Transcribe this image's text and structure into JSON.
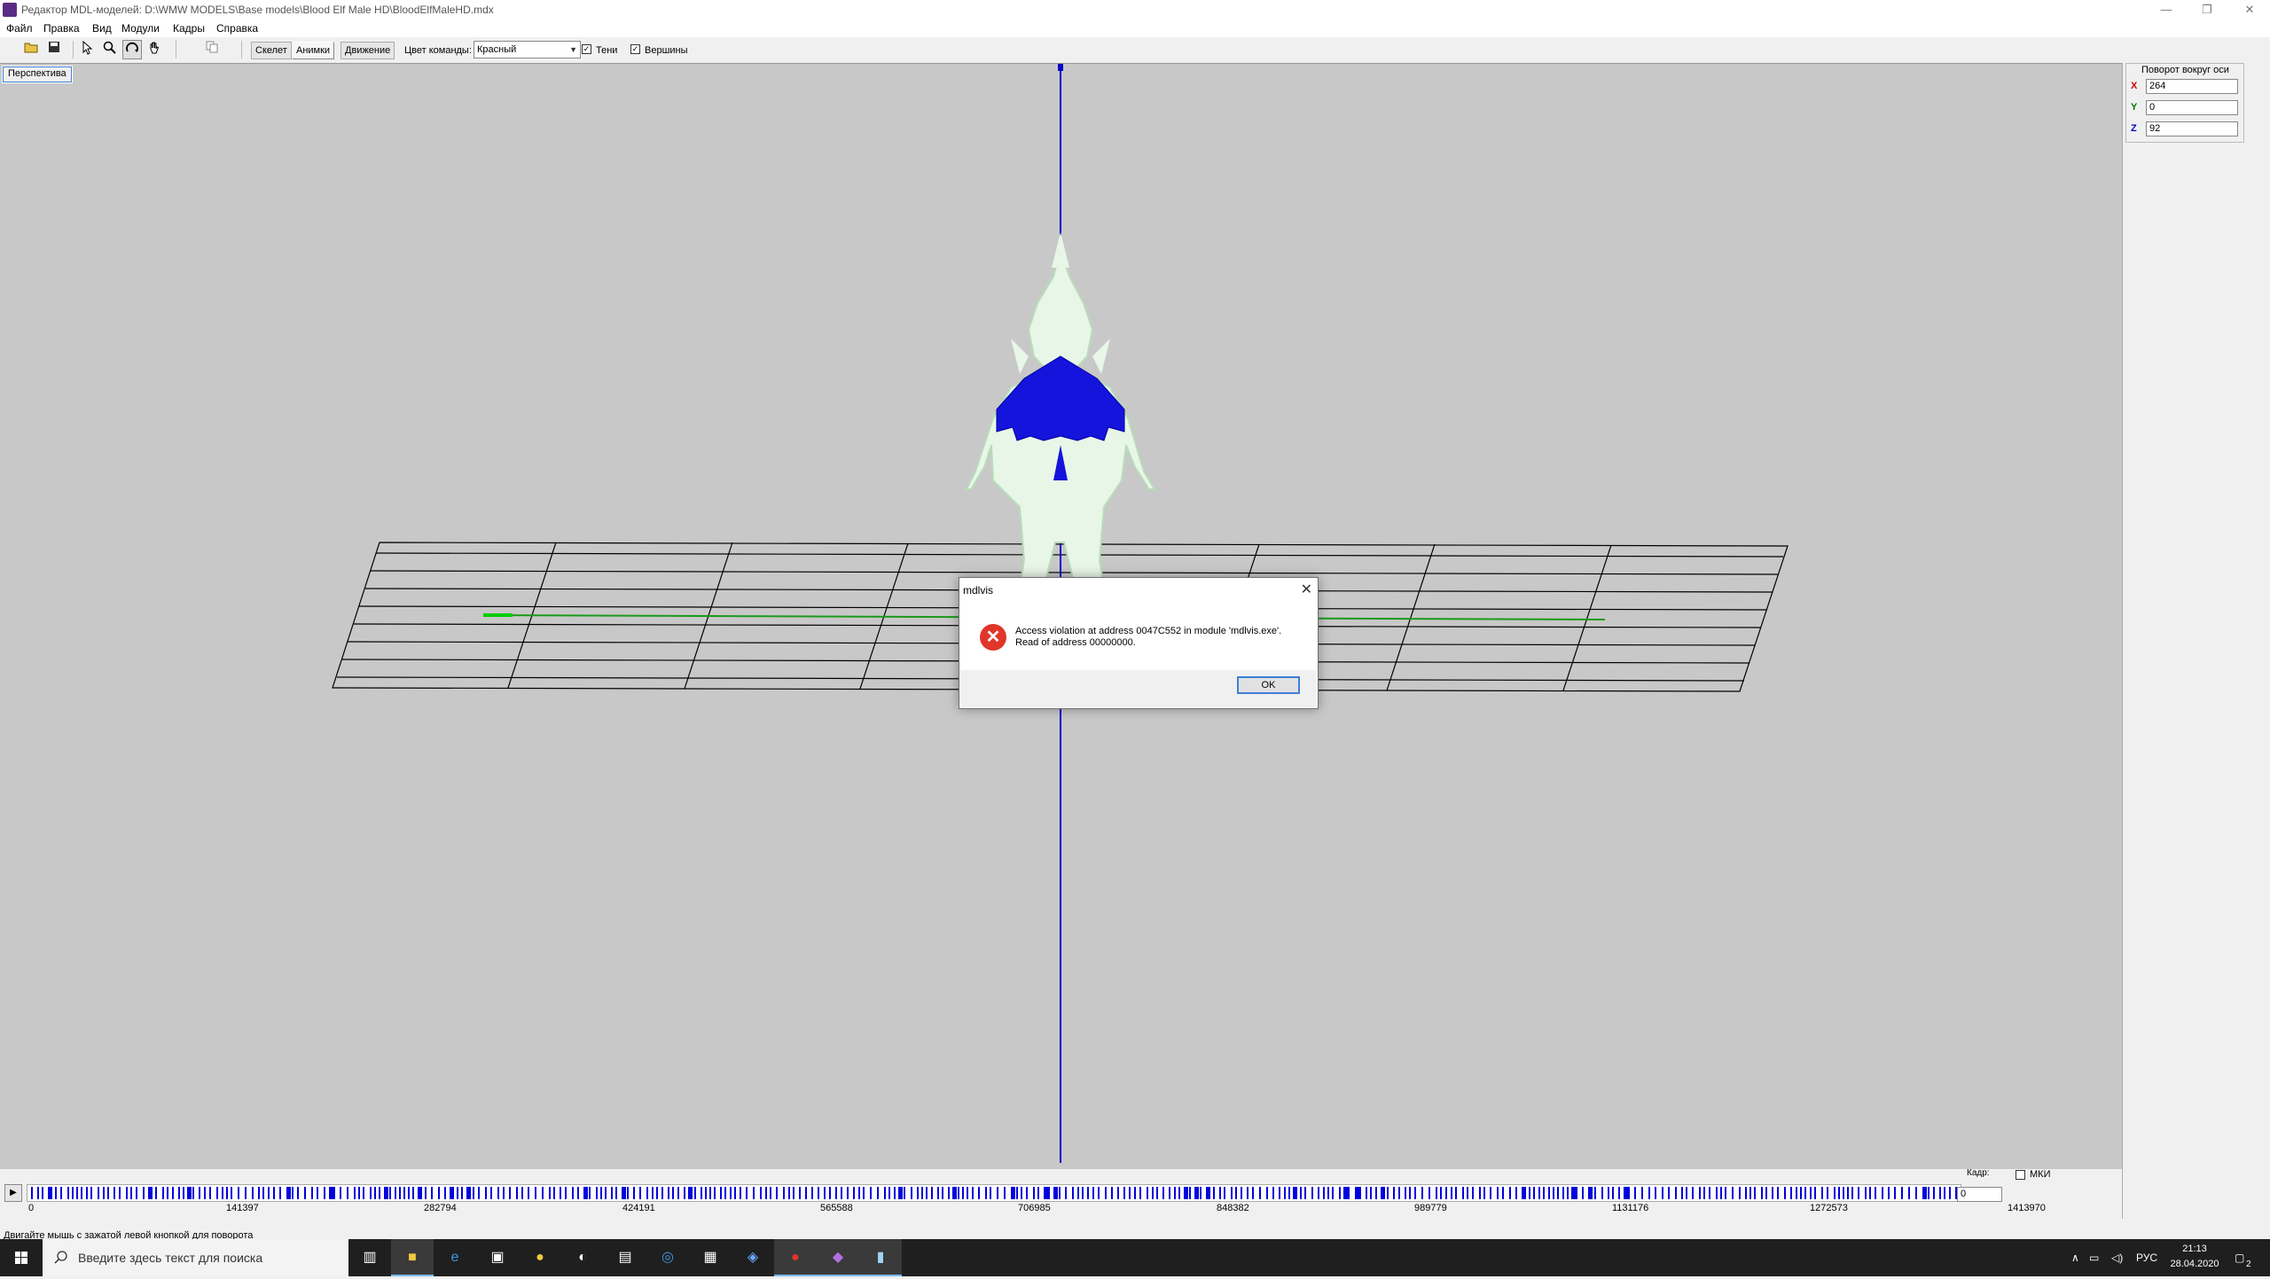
{
  "window": {
    "title": "Редактор MDL-моделей: D:\\WMW MODELS\\Base models\\Blood Elf Male HD\\BloodElfMaleHD.mdx",
    "controls": [
      "—",
      "❐",
      "✕"
    ]
  },
  "menu": [
    "Файл",
    "Правка",
    "Вид",
    "Модули",
    "Кадры",
    "Справка"
  ],
  "toolbar": {
    "tabs": [
      "Скелет",
      "Анимки",
      "Движение"
    ],
    "team_color_label": "Цвет команды:",
    "team_color_value": "Красный",
    "shadows_label": "Тени",
    "shadows_checked": true,
    "vertices_label": "Вершины",
    "vertices_checked": true
  },
  "viewport": {
    "perspective_button": "Перспектива"
  },
  "rotation_panel": {
    "title": "Поворот вокруг оси",
    "axes": [
      {
        "label": "X",
        "value": "264",
        "color": "#cc0000"
      },
      {
        "label": "Y",
        "value": "0",
        "color": "#007a00"
      },
      {
        "label": "Z",
        "value": "92",
        "color": "#0000cc"
      }
    ]
  },
  "timeline": {
    "ticks": [
      "0",
      "141397",
      "282794",
      "424191",
      "565588",
      "706985",
      "848382",
      "989779",
      "1131176",
      "1272573",
      "1413970"
    ],
    "frame_label": "Кадр:",
    "frame_value": "0",
    "mki_label": "МКИ",
    "mki_checked": false
  },
  "status": {
    "text": "Двигайте мышь с зажатой левой кнопкой для поворота"
  },
  "dialog": {
    "title": "mdlvis",
    "line1": "Access violation at address 0047C552 in module 'mdlvis.exe'.",
    "line2": "Read of address 00000000.",
    "ok": "OK"
  },
  "taskbar": {
    "search_placeholder": "Введите здесь текст для поиска",
    "time": "21:13",
    "date": "28.04.2020",
    "lang": "РУС",
    "notifications": "2"
  }
}
